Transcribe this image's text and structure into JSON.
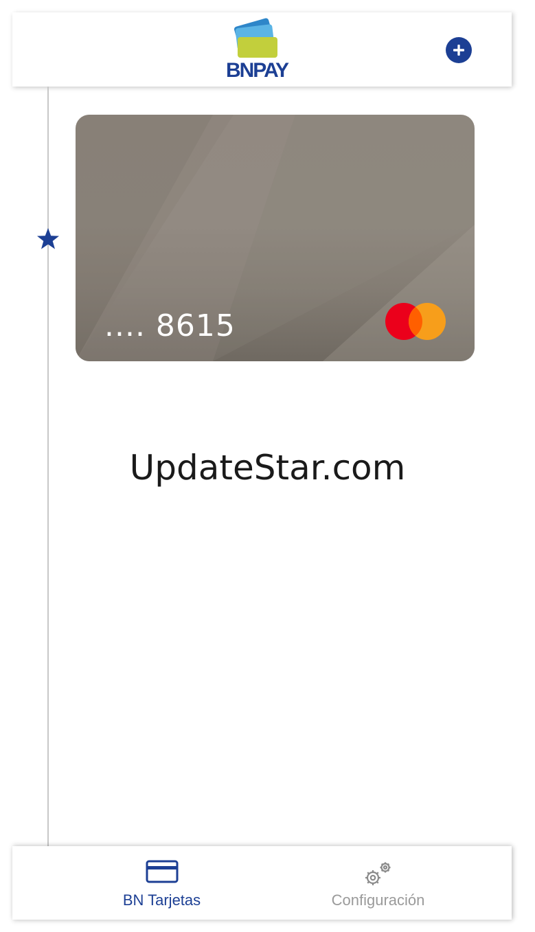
{
  "header": {
    "logo_text": "BNPAY",
    "add_icon": "plus-circle-icon"
  },
  "timeline": {
    "favorite_icon": "star-icon"
  },
  "card": {
    "number_masked": ".... 8615",
    "network_icon": "mastercard-logo"
  },
  "watermark": "UpdateStar.com",
  "bottom_nav": {
    "tabs": [
      {
        "label": "BN Tarjetas",
        "icon": "credit-card-icon",
        "active": true
      },
      {
        "label": "Configuración",
        "icon": "gears-icon",
        "active": false
      }
    ]
  },
  "colors": {
    "brand_blue": "#1c3f94",
    "logo_green": "#c2cf3c",
    "logo_light_blue": "#5bb4e5",
    "card_gray": "#8e877e",
    "mastercard_red": "#eb001b",
    "mastercard_orange": "#f79e1b",
    "inactive_gray": "#9a9a9a"
  }
}
